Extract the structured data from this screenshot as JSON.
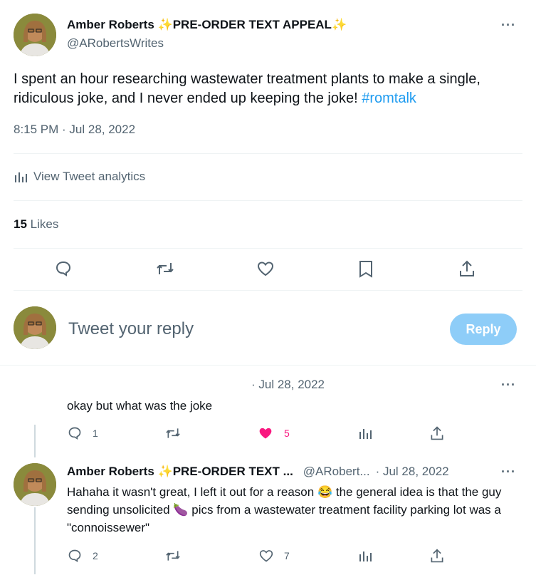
{
  "main_tweet": {
    "author_name": "Amber Roberts",
    "author_suffix": "PRE-ORDER TEXT APPEAL",
    "handle": "@ARobertsWrites",
    "text": "I spent an hour researching wastewater treatment plants to make a single, ridiculous joke, and I never ended up keeping the joke!",
    "hashtag": "#romtalk",
    "time": "8:15 PM",
    "date": "Jul 28, 2022",
    "analytics_label": "View Tweet analytics",
    "likes_count": "15",
    "likes_label": "Likes"
  },
  "reply_box": {
    "placeholder": "Tweet your reply",
    "button_label": "Reply"
  },
  "reply1": {
    "date": "· Jul 28, 2022",
    "text": "okay but what was the joke",
    "reply_count": "1",
    "like_count": "5"
  },
  "reply2": {
    "author_name": "Amber Roberts",
    "author_suffix": "PRE-ORDER TEXT ...",
    "handle": "@ARobert...",
    "date": "· Jul 28, 2022",
    "text_part1": "Hahaha it wasn't great, I left it out for a reason",
    "text_part2": "the general idea is that the guy sending unsolicited",
    "text_part3": "pics from a wastewater treatment facility parking lot was a \"connoissewer\"",
    "reply_count": "2",
    "like_count": "7"
  },
  "colors": {
    "accent": "#1d9bf0",
    "like_pink": "#f91880",
    "reply_button": "#8ecdf8",
    "secondary_text": "#536471"
  }
}
